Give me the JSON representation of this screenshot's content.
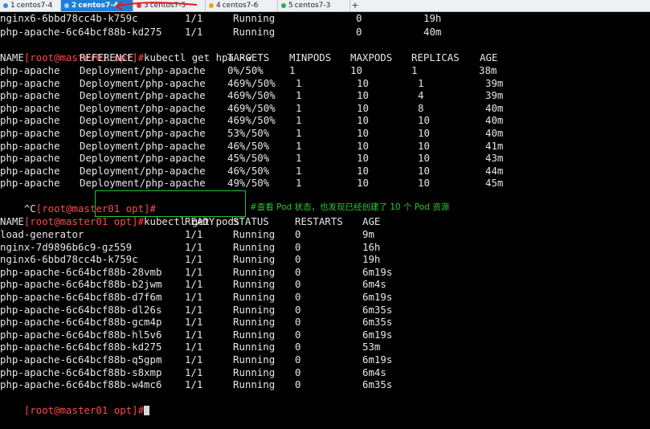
{
  "tabs": [
    {
      "num": "1",
      "label": "centos7-4",
      "dot": "#2b8ee6",
      "active": false
    },
    {
      "num": "2",
      "label": "centos7-4",
      "dot": "#2b8ee6",
      "active": true
    },
    {
      "num": "3",
      "label": "centos7-5",
      "dot": "#e23b3b",
      "active": false
    },
    {
      "num": "4",
      "label": "centos7-6",
      "dot": "#e0b000",
      "active": false
    },
    {
      "num": "5",
      "label": "centos7-3",
      "dot": "#22b24c",
      "active": false
    }
  ],
  "new_tab_label": "+",
  "prompt": "[root@master01 opt]#",
  "top_pods": [
    {
      "name": "nginx6-6bbd78cc4b-k759c",
      "ready": "1/1",
      "status": "Running",
      "restarts": "0",
      "age": "19h"
    },
    {
      "name": "php-apache-6c64bcf88b-kd275",
      "ready": "1/1",
      "status": "Running",
      "restarts": "0",
      "age": "40m"
    }
  ],
  "hpa_command": "kubectl get hpa -w",
  "hpa_headers": {
    "name": "NAME",
    "reference": "REFERENCE",
    "targets": "TARGETS",
    "minpods": "MINPODS",
    "maxpods": "MAXPODS",
    "replicas": "REPLICAS",
    "age": "AGE"
  },
  "hpa_rows": [
    {
      "name": "php-apache",
      "reference": "Deployment/php-apache",
      "targets": "0%/50%",
      "minpods": "1",
      "maxpods": "10",
      "replicas": "1",
      "age": "38m"
    },
    {
      "name": "php-apache",
      "reference": "Deployment/php-apache",
      "targets": "469%/50%",
      "minpods": "1",
      "maxpods": "10",
      "replicas": "1",
      "age": "39m"
    },
    {
      "name": "php-apache",
      "reference": "Deployment/php-apache",
      "targets": "469%/50%",
      "minpods": "1",
      "maxpods": "10",
      "replicas": "4",
      "age": "39m"
    },
    {
      "name": "php-apache",
      "reference": "Deployment/php-apache",
      "targets": "469%/50%",
      "minpods": "1",
      "maxpods": "10",
      "replicas": "8",
      "age": "40m"
    },
    {
      "name": "php-apache",
      "reference": "Deployment/php-apache",
      "targets": "469%/50%",
      "minpods": "1",
      "maxpods": "10",
      "replicas": "10",
      "age": "40m"
    },
    {
      "name": "php-apache",
      "reference": "Deployment/php-apache",
      "targets": "53%/50%",
      "minpods": "1",
      "maxpods": "10",
      "replicas": "10",
      "age": "40m"
    },
    {
      "name": "php-apache",
      "reference": "Deployment/php-apache",
      "targets": "46%/50%",
      "minpods": "1",
      "maxpods": "10",
      "replicas": "10",
      "age": "41m"
    },
    {
      "name": "php-apache",
      "reference": "Deployment/php-apache",
      "targets": "45%/50%",
      "minpods": "1",
      "maxpods": "10",
      "replicas": "10",
      "age": "43m"
    },
    {
      "name": "php-apache",
      "reference": "Deployment/php-apache",
      "targets": "46%/50%",
      "minpods": "1",
      "maxpods": "10",
      "replicas": "10",
      "age": "44m"
    },
    {
      "name": "php-apache",
      "reference": "Deployment/php-apache",
      "targets": "49%/50%",
      "minpods": "1",
      "maxpods": "10",
      "replicas": "10",
      "age": "45m"
    }
  ],
  "interrupt": "^C",
  "pods_command": "kubectl get pods",
  "annotation": "#查看 Pod 状态，也发现已经创建了 10 个 Pod 资源",
  "pod_headers": {
    "name": "NAME",
    "ready": "READY",
    "status": "STATUS",
    "restarts": "RESTARTS",
    "age": "AGE"
  },
  "pod_rows": [
    {
      "name": "load-generator",
      "ready": "1/1",
      "status": "Running",
      "restarts": "0",
      "age": "9m"
    },
    {
      "name": "nginx-7d9896b6c9-gz559",
      "ready": "1/1",
      "status": "Running",
      "restarts": "0",
      "age": "16h"
    },
    {
      "name": "nginx6-6bbd78cc4b-k759c",
      "ready": "1/1",
      "status": "Running",
      "restarts": "0",
      "age": "19h"
    },
    {
      "name": "php-apache-6c64bcf88b-28vmb",
      "ready": "1/1",
      "status": "Running",
      "restarts": "0",
      "age": "6m19s"
    },
    {
      "name": "php-apache-6c64bcf88b-b2jwm",
      "ready": "1/1",
      "status": "Running",
      "restarts": "0",
      "age": "6m4s"
    },
    {
      "name": "php-apache-6c64bcf88b-d7f6m",
      "ready": "1/1",
      "status": "Running",
      "restarts": "0",
      "age": "6m19s"
    },
    {
      "name": "php-apache-6c64bcf88b-dl26s",
      "ready": "1/1",
      "status": "Running",
      "restarts": "0",
      "age": "6m35s"
    },
    {
      "name": "php-apache-6c64bcf88b-gcm4p",
      "ready": "1/1",
      "status": "Running",
      "restarts": "0",
      "age": "6m35s"
    },
    {
      "name": "php-apache-6c64bcf88b-hl5v6",
      "ready": "1/1",
      "status": "Running",
      "restarts": "0",
      "age": "6m19s"
    },
    {
      "name": "php-apache-6c64bcf88b-kd275",
      "ready": "1/1",
      "status": "Running",
      "restarts": "0",
      "age": "53m"
    },
    {
      "name": "php-apache-6c64bcf88b-q5gpm",
      "ready": "1/1",
      "status": "Running",
      "restarts": "0",
      "age": "6m19s"
    },
    {
      "name": "php-apache-6c64bcf88b-s8xmp",
      "ready": "1/1",
      "status": "Running",
      "restarts": "0",
      "age": "6m4s"
    },
    {
      "name": "php-apache-6c64bcf88b-w4mc6",
      "ready": "1/1",
      "status": "Running",
      "restarts": "0",
      "age": "6m35s"
    }
  ],
  "colors": {
    "prompt": "#ff4a4a",
    "annotation": "#2ec531",
    "terminal_bg": "#000000",
    "terminal_fg": "#e6e6e6",
    "active_tab": "#1f7fd8"
  }
}
